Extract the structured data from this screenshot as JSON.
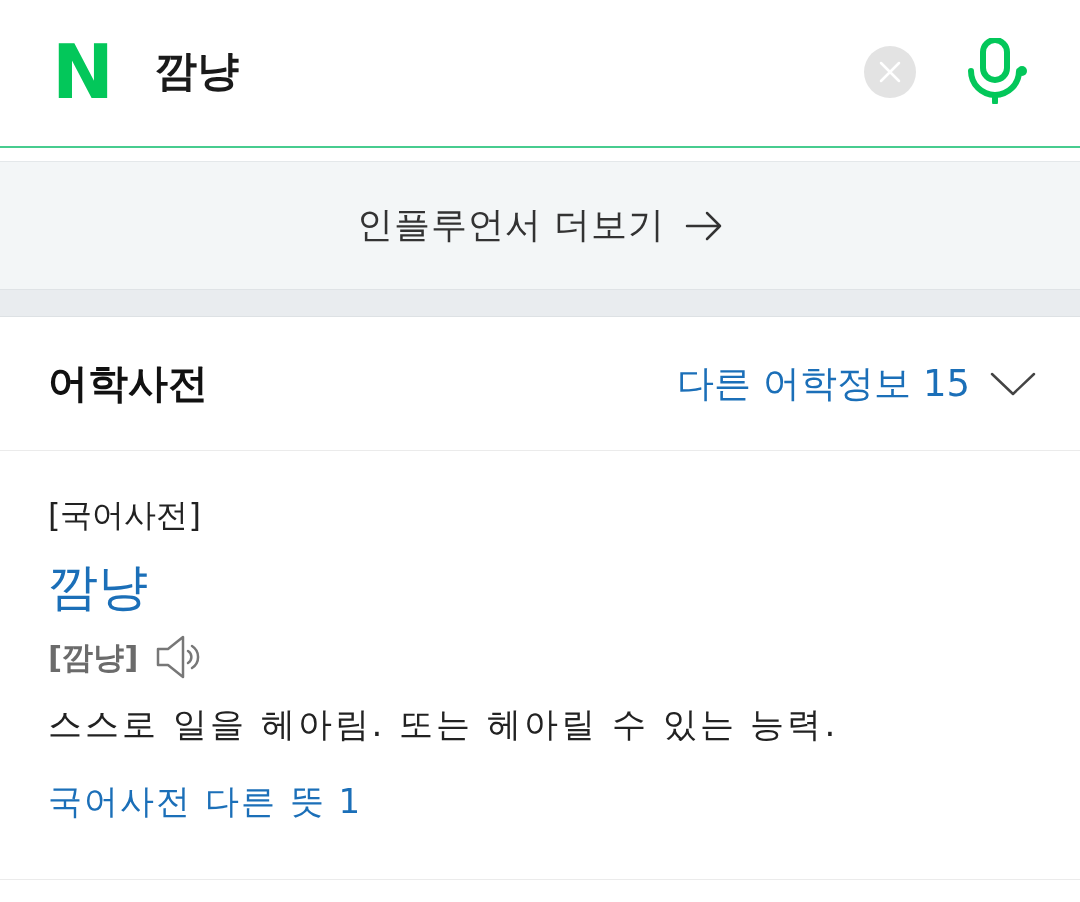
{
  "search_bar": {
    "logo": "N",
    "query": "깜냥"
  },
  "influencer_button": {
    "label": "인플루언서 더보기"
  },
  "dictionary_section": {
    "title": "어학사전",
    "more_link": {
      "label": "다른 어학정보 15",
      "expanded": false
    }
  },
  "entry": {
    "source": "[국어사전]",
    "headword": "깜냥",
    "pronunciation": "[깜냥]",
    "definition": "스스로 일을 헤아림. 또는 헤아릴 수 있는 능력.",
    "other_meanings_link": "국어사전 다른 뜻 1"
  }
}
